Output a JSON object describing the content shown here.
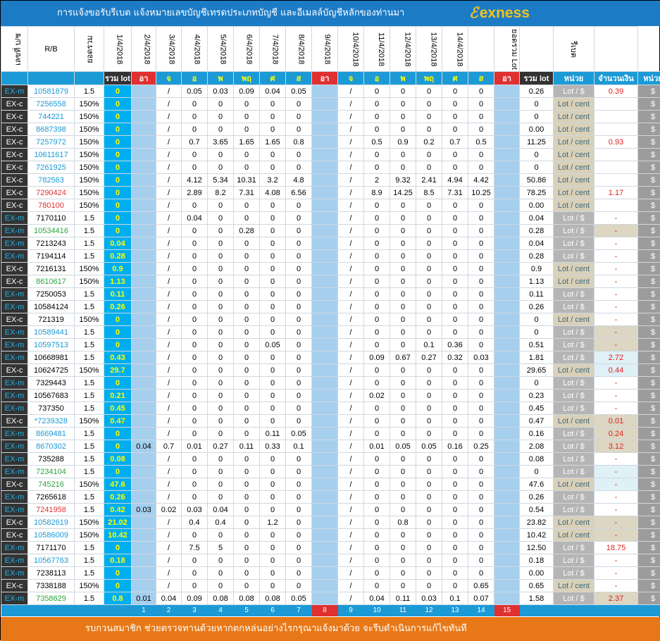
{
  "header": {
    "title": "การแจ้งขอรับรีเบต  แจ้งหมายเลขบัญชีเทรดประเภทบัญชี และอีเมลล์บัญชีหลักของท่านมา",
    "logo": "exness",
    "logo_mark": "ℰ",
    "col_account": "เลขที่ บ/ช",
    "col_rb": "R/B",
    "col_total_vertical": "ยอดรวม",
    "col_sum_vertical": "ยอดรวม Lot",
    "col_amount_vertical": "รีเบต",
    "dates": [
      "1/4/2018",
      "2/4/2018",
      "3/4/2018",
      "4/4/2018",
      "5/4/2018",
      "6/4/2018",
      "7/4/2018",
      "8/4/2018",
      "9/4/2018",
      "10/4/2018",
      "11/4/2018",
      "12/4/2018",
      "13/4/2018",
      "14/4/2018"
    ],
    "sub": {
      "lot": "รวม lot",
      "days": [
        "อา",
        "จ",
        "อ",
        "พ",
        "พฤ",
        "ศ",
        "ส",
        "อา",
        "จ",
        "อ",
        "พ",
        "พฤ",
        "ศ",
        "ส",
        "อา"
      ],
      "sum_lot": "รวม lot",
      "unit": "หน่วย",
      "amount": "จำนวนเงิน",
      "unit2": "หน่วย"
    }
  },
  "rows": [
    [
      "EX-m",
      "10581879",
      "1.5",
      "0",
      "",
      "/",
      "0.05",
      "0.03",
      "0.09",
      "0.04",
      "0.05",
      "",
      "/",
      "0",
      "0",
      "0",
      "0",
      "0",
      "",
      "0.26",
      "Lot / $",
      "0.39",
      "$"
    ],
    [
      "EX-c",
      "7256558",
      "150%",
      "0",
      "",
      "/",
      "0",
      "0",
      "0",
      "0",
      "0",
      "",
      "/",
      "0",
      "0",
      "0",
      "0",
      "0",
      "",
      "0",
      "Lot / cent",
      "",
      "$"
    ],
    [
      "EX-c",
      "744221",
      "150%",
      "0",
      "",
      "/",
      "0",
      "0",
      "0",
      "0",
      "0",
      "",
      "/",
      "0",
      "0",
      "0",
      "0",
      "0",
      "",
      "0",
      "Lot / cent",
      "",
      "$"
    ],
    [
      "EX-c",
      "8687398",
      "150%",
      "0",
      "",
      "/",
      "0",
      "0",
      "0",
      "0",
      "0",
      "",
      "/",
      "0",
      "0",
      "0",
      "0",
      "0",
      "",
      "0.00",
      "Lot / cent",
      "",
      "$"
    ],
    [
      "EX-c",
      "7257972",
      "150%",
      "0",
      "",
      "/",
      "0.7",
      "3.65",
      "1.65",
      "1.65",
      "0.8",
      "",
      "/",
      "0.5",
      "0.9",
      "0.2",
      "0.7",
      "0.5",
      "",
      "11.25",
      "Lot / cent",
      "0.93",
      "$"
    ],
    [
      "EX-c",
      "10611617",
      "150%",
      "0",
      "",
      "/",
      "0",
      "0",
      "0",
      "0",
      "0",
      "",
      "/",
      "0",
      "0",
      "0",
      "0",
      "0",
      "",
      "0",
      "Lot / cent",
      "",
      "$"
    ],
    [
      "EX-c",
      "7261925",
      "150%",
      "0",
      "",
      "/",
      "0",
      "0",
      "0",
      "0",
      "0",
      "",
      "/",
      "0",
      "0",
      "0",
      "0",
      "0",
      "",
      "0",
      "Lot / cent",
      "",
      "$"
    ],
    [
      "EX-c",
      "782563",
      "150%",
      "0",
      "",
      "/",
      "4.12",
      "5.34",
      "10.31",
      "3.2",
      "4.8",
      "",
      "/",
      "2",
      "9.32",
      "2.41",
      "4.94",
      "4.42",
      "",
      "50.86",
      "Lot / cent",
      "",
      "$"
    ],
    [
      "EX-c",
      "7290424",
      "150%",
      "0",
      "",
      "/",
      "2.89",
      "8.2",
      "7.31",
      "4.08",
      "6.56",
      "",
      "/",
      "8.9",
      "14.25",
      "8.5",
      "7.31",
      "10.25",
      "",
      "78.25",
      "Lot / cent",
      "1.17",
      "$"
    ],
    [
      "EX-c",
      "780100",
      "150%",
      "0",
      "",
      "/",
      "0",
      "0",
      "0",
      "0",
      "0",
      "",
      "/",
      "0",
      "0",
      "0",
      "0",
      "0",
      "",
      "0.00",
      "Lot / cent",
      "",
      "$"
    ],
    [
      "EX-m",
      "7170110",
      "1.5",
      "0",
      "",
      "/",
      "0.04",
      "0",
      "0",
      "0",
      "0",
      "",
      "/",
      "0",
      "0",
      "0",
      "0",
      "0",
      "",
      "0.04",
      "Lot / $",
      "-",
      "$"
    ],
    [
      "EX-m",
      "10534416",
      "1.5",
      "0",
      "",
      "/",
      "0",
      "0",
      "0.28",
      "0",
      "0",
      "",
      "/",
      "0",
      "0",
      "0",
      "0",
      "0",
      "",
      "0.28",
      "Lot / $",
      "-",
      "$"
    ],
    [
      "EX-m",
      "7213243",
      "1.5",
      "0.04",
      "",
      "/",
      "0",
      "0",
      "0",
      "0",
      "0",
      "",
      "/",
      "0",
      "0",
      "0",
      "0",
      "0",
      "",
      "0.04",
      "Lot / $",
      "-",
      "$"
    ],
    [
      "EX-m",
      "7194114",
      "1.5",
      "0.28",
      "",
      "/",
      "0",
      "0",
      "0",
      "0",
      "0",
      "",
      "/",
      "0",
      "0",
      "0",
      "0",
      "0",
      "",
      "0.28",
      "Lot / $",
      "-",
      "$"
    ],
    [
      "EX-c",
      "7216131",
      "150%",
      "0.9",
      "",
      "/",
      "0",
      "0",
      "0",
      "0",
      "0",
      "",
      "/",
      "0",
      "0",
      "0",
      "0",
      "0",
      "",
      "0.9",
      "Lot / cent",
      "-",
      "$"
    ],
    [
      "EX-c",
      "8610617",
      "150%",
      "1.13",
      "",
      "/",
      "0",
      "0",
      "0",
      "0",
      "0",
      "",
      "/",
      "0",
      "0",
      "0",
      "0",
      "0",
      "",
      "1.13",
      "Lot / cent",
      "-",
      "$"
    ],
    [
      "EX-m",
      "7250053",
      "1.5",
      "0.11",
      "",
      "/",
      "0",
      "0",
      "0",
      "0",
      "0",
      "",
      "/",
      "0",
      "0",
      "0",
      "0",
      "0",
      "",
      "0.11",
      "Lot / $",
      "-",
      "$"
    ],
    [
      "EX-m",
      "10584124",
      "1.5",
      "0.26",
      "",
      "/",
      "0",
      "0",
      "0",
      "0",
      "0",
      "",
      "/",
      "0",
      "0",
      "0",
      "0",
      "0",
      "",
      "0.26",
      "Lot / $",
      "-",
      "$"
    ],
    [
      "EX-c",
      "721319",
      "150%",
      "0",
      "",
      "/",
      "0",
      "0",
      "0",
      "0",
      "0",
      "",
      "/",
      "0",
      "0",
      "0",
      "0",
      "0",
      "",
      "0",
      "Lot / cent",
      "-",
      "$"
    ],
    [
      "EX-m",
      "10589441",
      "1.5",
      "0",
      "",
      "/",
      "0",
      "0",
      "0",
      "0",
      "0",
      "",
      "/",
      "0",
      "0",
      "0",
      "0",
      "0",
      "",
      "0",
      "Lot / $",
      "-",
      "$"
    ],
    [
      "EX-m",
      "10597513",
      "1.5",
      "0",
      "",
      "/",
      "0",
      "0",
      "0",
      "0.05",
      "0",
      "",
      "/",
      "0",
      "0",
      "0.1",
      "0.36",
      "0",
      "",
      "0.51",
      "Lot / $",
      "-",
      "$"
    ],
    [
      "EX-m",
      "10668981",
      "1.5",
      "0.43",
      "",
      "/",
      "0",
      "0",
      "0",
      "0",
      "0",
      "",
      "/",
      "0.09",
      "0.67",
      "0.27",
      "0.32",
      "0.03",
      "",
      "1.81",
      "Lot / $",
      "2.72",
      "$"
    ],
    [
      "EX-c",
      "10624725",
      "150%",
      "29.7",
      "",
      "/",
      "0",
      "0",
      "0",
      "0",
      "0",
      "",
      "/",
      "0",
      "0",
      "0",
      "0",
      "0",
      "",
      "29.65",
      "Lot / cent",
      "0.44",
      "$"
    ],
    [
      "EX-m",
      "7329443",
      "1.5",
      "0",
      "",
      "/",
      "0",
      "0",
      "0",
      "0",
      "0",
      "",
      "/",
      "0",
      "0",
      "0",
      "0",
      "0",
      "",
      "0",
      "Lot / $",
      "-",
      "$"
    ],
    [
      "EX-m",
      "10567683",
      "1.5",
      "0.21",
      "",
      "/",
      "0",
      "0",
      "0",
      "0",
      "0",
      "",
      "/",
      "0.02",
      "0",
      "0",
      "0",
      "0",
      "",
      "0.23",
      "Lot / $",
      "-",
      "$"
    ],
    [
      "EX-m",
      "737350",
      "1.5",
      "0.45",
      "",
      "/",
      "0",
      "0",
      "0",
      "0",
      "0",
      "",
      "/",
      "0",
      "0",
      "0",
      "0",
      "0",
      "",
      "0.45",
      "Lot / $",
      "-",
      "$"
    ],
    [
      "EX-c",
      "*7239328",
      "150%",
      "0.47",
      "",
      "/",
      "0",
      "0",
      "0",
      "0",
      "0",
      "",
      "/",
      "0",
      "0",
      "0",
      "0",
      "0",
      "",
      "0.47",
      "Lot / cent",
      "0.01",
      "$"
    ],
    [
      "EX-m",
      "8669481",
      "1.5",
      "0",
      "",
      "/",
      "0",
      "0",
      "0",
      "0.11",
      "0.05",
      "",
      "/",
      "0",
      "0",
      "0",
      "0",
      "0",
      "",
      "0.16",
      "Lot / $",
      "0.24",
      "$"
    ],
    [
      "EX-m",
      "8670302",
      "1.5",
      "0",
      "0.04",
      "0.7",
      "0.01",
      "0.27",
      "0.11",
      "0.33",
      "0.1",
      "",
      "/",
      "0.01",
      "0.05",
      "0.05",
      "0.16",
      "0.25",
      "",
      "2.08",
      "Lot / $",
      "3.12",
      "$"
    ],
    [
      "EX-m",
      "735288",
      "1.5",
      "0.08",
      "",
      "/",
      "0",
      "0",
      "0",
      "0",
      "0",
      "",
      "/",
      "0",
      "0",
      "0",
      "0",
      "0",
      "",
      "0.08",
      "Lot / $",
      "-",
      "$"
    ],
    [
      "EX-m",
      "7234104",
      "1.5",
      "0",
      "",
      "/",
      "0",
      "0",
      "0",
      "0",
      "0",
      "",
      "/",
      "0",
      "0",
      "0",
      "0",
      "0",
      "",
      "0",
      "Lot / $",
      "-",
      "$"
    ],
    [
      "EX-c",
      "745216",
      "150%",
      "47.6",
      "",
      "/",
      "0",
      "0",
      "0",
      "0",
      "0",
      "",
      "/",
      "0",
      "0",
      "0",
      "0",
      "0",
      "",
      "47.6",
      "Lot / cent",
      "-",
      "$"
    ],
    [
      "EX-m",
      "7265618",
      "1.5",
      "0.26",
      "",
      "/",
      "0",
      "0",
      "0",
      "0",
      "0",
      "",
      "/",
      "0",
      "0",
      "0",
      "0",
      "0",
      "",
      "0.26",
      "Lot / $",
      "-",
      "$"
    ],
    [
      "EX-m",
      "7241958",
      "1.5",
      "0.42",
      "0.03",
      "0.02",
      "0.03",
      "0.04",
      "0",
      "0",
      "0",
      "",
      "/",
      "0",
      "0",
      "0",
      "0",
      "0",
      "",
      "0.54",
      "Lot / $",
      "-",
      "$"
    ],
    [
      "EX-c",
      "10582619",
      "150%",
      "21.02",
      "",
      "/",
      "0.4",
      "0.4",
      "0",
      "1.2",
      "0",
      "",
      "/",
      "0",
      "0.8",
      "0",
      "0",
      "0",
      "",
      "23.82",
      "Lot / cent",
      "-",
      "$"
    ],
    [
      "EX-c",
      "10586009",
      "150%",
      "10.42",
      "",
      "/",
      "0",
      "0",
      "0",
      "0",
      "0",
      "",
      "/",
      "0",
      "0",
      "0",
      "0",
      "0",
      "",
      "10.42",
      "Lot / cent",
      "-",
      "$"
    ],
    [
      "EX-m",
      "7171170",
      "1.5",
      "0",
      "",
      "/",
      "7.5",
      "5",
      "0",
      "0",
      "0",
      "",
      "/",
      "0",
      "0",
      "0",
      "0",
      "0",
      "",
      "12.50",
      "Lot / $",
      "18.75",
      "$"
    ],
    [
      "EX-m",
      "10567763",
      "1.5",
      "0.18",
      "",
      "/",
      "0",
      "0",
      "0",
      "0",
      "0",
      "",
      "/",
      "0",
      "0",
      "0",
      "0",
      "0",
      "",
      "0.18",
      "Lot / $",
      "-",
      "$"
    ],
    [
      "EX-m",
      "7238113",
      "1.5",
      "0",
      "",
      "/",
      "0",
      "0",
      "0",
      "0",
      "0",
      "",
      "/",
      "0",
      "0",
      "0",
      "0",
      "0",
      "",
      "0.00",
      "Lot / $",
      "-",
      "$"
    ],
    [
      "EX-c",
      "7338188",
      "150%",
      "0",
      "",
      "/",
      "0",
      "0",
      "0",
      "0",
      "0",
      "",
      "/",
      "0",
      "0",
      "0",
      "0",
      "0.65",
      "",
      "0.65",
      "Lot / cent",
      "-",
      "$"
    ],
    [
      "EX-m",
      "7358629",
      "1.5",
      "0.8",
      "0.01",
      "0.04",
      "0.09",
      "0.08",
      "0.08",
      "0.08",
      "0.05",
      "",
      "/",
      "0.04",
      "0.11",
      "0.03",
      "0.1",
      "0.07",
      "",
      "1.58",
      "Lot / $",
      "2.37",
      "$"
    ]
  ],
  "acc_colors": [
    "blue",
    "blue",
    "blue",
    "blue",
    "blue",
    "blue",
    "blue",
    "blue",
    "red",
    "red",
    "blk",
    "green",
    "blk",
    "blk",
    "blk",
    "green",
    "blk",
    "blk",
    "blk",
    "blue",
    "blue",
    "blk",
    "blk",
    "blk",
    "blk",
    "blk",
    "blue",
    "blue",
    "blue",
    "blk",
    "green",
    "green",
    "blk",
    "red",
    "blue",
    "blue",
    "blk",
    "blue",
    "blk",
    "blk",
    "green"
  ],
  "amt_bg": [
    "",
    "",
    "",
    "",
    "",
    "",
    "",
    "",
    "",
    "",
    "",
    "beige",
    "",
    "",
    "",
    "",
    "",
    "",
    "",
    "beige",
    "beige",
    "lblue",
    "lblue",
    "",
    "",
    "",
    "beige",
    "beige",
    "beige",
    "",
    "lblue",
    "lblue",
    "",
    "",
    "beige",
    "beige",
    "",
    "",
    "",
    "",
    "beige"
  ],
  "footer_nums": [
    "1",
    "2",
    "3",
    "4",
    "5",
    "6",
    "7",
    "8",
    "9",
    "10",
    "11",
    "12",
    "13",
    "14",
    "15"
  ],
  "footer": {
    "text": "รบกวนสมาชิก ช่วยตรวจทานด้วยหากตกหล่นอย่างไรกรุณาแจ้งมาด้วย จะรีบดำเนินการแก้ไขทันที"
  }
}
